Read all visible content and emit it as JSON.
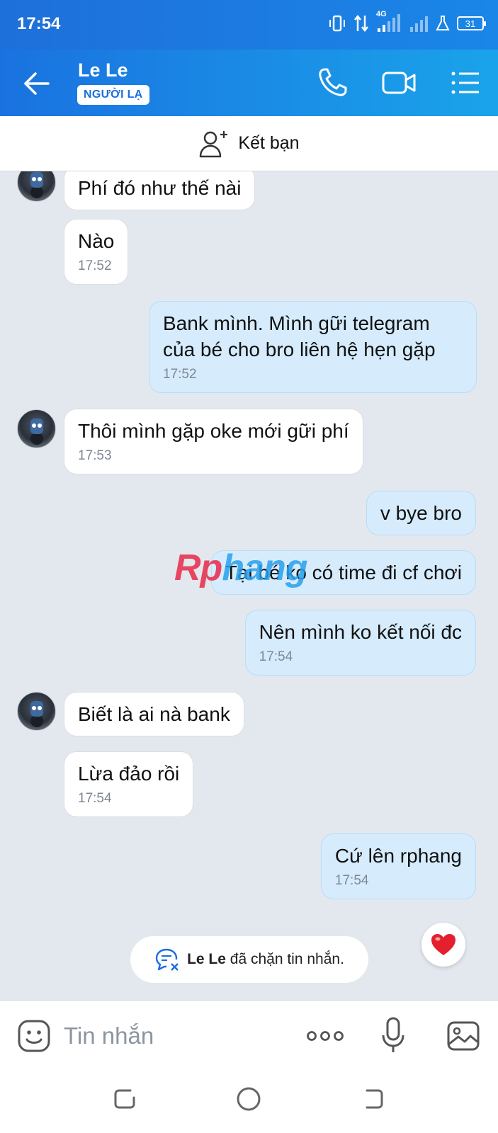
{
  "status_bar": {
    "time": "17:54",
    "network": "4G",
    "battery": "31"
  },
  "header": {
    "contact_name": "Le Le",
    "stranger_badge": "NGƯỜI LẠ",
    "back_icon": "arrow-left-icon",
    "call_icon": "phone-icon",
    "video_icon": "video-camera-icon",
    "menu_icon": "list-menu-icon"
  },
  "add_friend": {
    "label": "Kết bạn",
    "icon": "add-person-icon"
  },
  "messages": [
    {
      "dir": "in",
      "text": "Phí đó như thế nài",
      "time": ""
    },
    {
      "dir": "in",
      "text": "Nào",
      "time": "17:52"
    },
    {
      "dir": "out",
      "text": "Bank mình. Mình gữi telegram của bé cho bro liên hệ hẹn gặp",
      "time": "17:52"
    },
    {
      "dir": "in",
      "text": "Thôi mình gặp oke mới gữi phí",
      "time": "17:53"
    },
    {
      "dir": "out",
      "text": "v bye bro",
      "time": ""
    },
    {
      "dir": "out",
      "text": "Tại bé ko có time đi cf chơi",
      "time": ""
    },
    {
      "dir": "out",
      "text": "Nên mình ko kết nối đc",
      "time": "17:54"
    },
    {
      "dir": "in",
      "text": "Biết là ai nà bank",
      "time": ""
    },
    {
      "dir": "in",
      "text": "Lừa đảo rồi",
      "time": "17:54"
    },
    {
      "dir": "out",
      "text": "Cứ lên rphang",
      "time": "17:54"
    }
  ],
  "watermark": {
    "part1": "Rp",
    "part2": "hang"
  },
  "blocked_notice": {
    "name": "Le Le",
    "text": "đã chặn tin nhắn."
  },
  "input_bar": {
    "placeholder": "Tin nhắn"
  },
  "colors": {
    "header": "#1a86e8",
    "outgoing_bubble": "#d6ecfd",
    "chat_bg": "#e3e8ee",
    "accent": "#1a6ee0"
  }
}
